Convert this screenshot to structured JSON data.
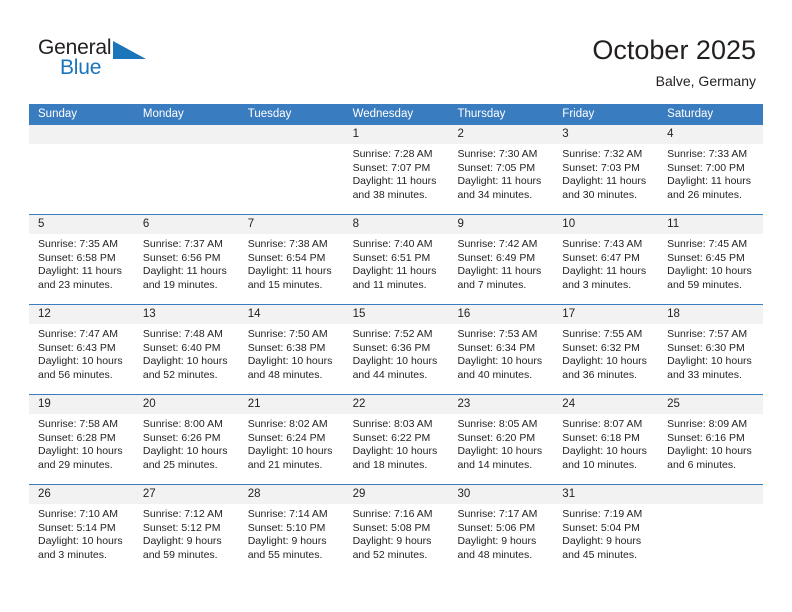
{
  "brand": {
    "name_top": "General",
    "name_bottom": "Blue",
    "color_dark": "#231f20",
    "color_blue": "#1b75bb",
    "triangle_icon": "triangle-icon"
  },
  "header": {
    "title": "October 2025",
    "subtitle": "Balve, Germany"
  },
  "theme": {
    "header_blue": "#3a7cc0",
    "daynum_band": "#f2f2f2",
    "text": "#231f20"
  },
  "weekdays": [
    "Sunday",
    "Monday",
    "Tuesday",
    "Wednesday",
    "Thursday",
    "Friday",
    "Saturday"
  ],
  "weeks": [
    [
      {
        "day": "",
        "sunrise": "",
        "sunset": "",
        "daylight1": "",
        "daylight2": ""
      },
      {
        "day": "",
        "sunrise": "",
        "sunset": "",
        "daylight1": "",
        "daylight2": ""
      },
      {
        "day": "",
        "sunrise": "",
        "sunset": "",
        "daylight1": "",
        "daylight2": ""
      },
      {
        "day": "1",
        "sunrise": "Sunrise: 7:28 AM",
        "sunset": "Sunset: 7:07 PM",
        "daylight1": "Daylight: 11 hours",
        "daylight2": "and 38 minutes."
      },
      {
        "day": "2",
        "sunrise": "Sunrise: 7:30 AM",
        "sunset": "Sunset: 7:05 PM",
        "daylight1": "Daylight: 11 hours",
        "daylight2": "and 34 minutes."
      },
      {
        "day": "3",
        "sunrise": "Sunrise: 7:32 AM",
        "sunset": "Sunset: 7:03 PM",
        "daylight1": "Daylight: 11 hours",
        "daylight2": "and 30 minutes."
      },
      {
        "day": "4",
        "sunrise": "Sunrise: 7:33 AM",
        "sunset": "Sunset: 7:00 PM",
        "daylight1": "Daylight: 11 hours",
        "daylight2": "and 26 minutes."
      }
    ],
    [
      {
        "day": "5",
        "sunrise": "Sunrise: 7:35 AM",
        "sunset": "Sunset: 6:58 PM",
        "daylight1": "Daylight: 11 hours",
        "daylight2": "and 23 minutes."
      },
      {
        "day": "6",
        "sunrise": "Sunrise: 7:37 AM",
        "sunset": "Sunset: 6:56 PM",
        "daylight1": "Daylight: 11 hours",
        "daylight2": "and 19 minutes."
      },
      {
        "day": "7",
        "sunrise": "Sunrise: 7:38 AM",
        "sunset": "Sunset: 6:54 PM",
        "daylight1": "Daylight: 11 hours",
        "daylight2": "and 15 minutes."
      },
      {
        "day": "8",
        "sunrise": "Sunrise: 7:40 AM",
        "sunset": "Sunset: 6:51 PM",
        "daylight1": "Daylight: 11 hours",
        "daylight2": "and 11 minutes."
      },
      {
        "day": "9",
        "sunrise": "Sunrise: 7:42 AM",
        "sunset": "Sunset: 6:49 PM",
        "daylight1": "Daylight: 11 hours",
        "daylight2": "and 7 minutes."
      },
      {
        "day": "10",
        "sunrise": "Sunrise: 7:43 AM",
        "sunset": "Sunset: 6:47 PM",
        "daylight1": "Daylight: 11 hours",
        "daylight2": "and 3 minutes."
      },
      {
        "day": "11",
        "sunrise": "Sunrise: 7:45 AM",
        "sunset": "Sunset: 6:45 PM",
        "daylight1": "Daylight: 10 hours",
        "daylight2": "and 59 minutes."
      }
    ],
    [
      {
        "day": "12",
        "sunrise": "Sunrise: 7:47 AM",
        "sunset": "Sunset: 6:43 PM",
        "daylight1": "Daylight: 10 hours",
        "daylight2": "and 56 minutes."
      },
      {
        "day": "13",
        "sunrise": "Sunrise: 7:48 AM",
        "sunset": "Sunset: 6:40 PM",
        "daylight1": "Daylight: 10 hours",
        "daylight2": "and 52 minutes."
      },
      {
        "day": "14",
        "sunrise": "Sunrise: 7:50 AM",
        "sunset": "Sunset: 6:38 PM",
        "daylight1": "Daylight: 10 hours",
        "daylight2": "and 48 minutes."
      },
      {
        "day": "15",
        "sunrise": "Sunrise: 7:52 AM",
        "sunset": "Sunset: 6:36 PM",
        "daylight1": "Daylight: 10 hours",
        "daylight2": "and 44 minutes."
      },
      {
        "day": "16",
        "sunrise": "Sunrise: 7:53 AM",
        "sunset": "Sunset: 6:34 PM",
        "daylight1": "Daylight: 10 hours",
        "daylight2": "and 40 minutes."
      },
      {
        "day": "17",
        "sunrise": "Sunrise: 7:55 AM",
        "sunset": "Sunset: 6:32 PM",
        "daylight1": "Daylight: 10 hours",
        "daylight2": "and 36 minutes."
      },
      {
        "day": "18",
        "sunrise": "Sunrise: 7:57 AM",
        "sunset": "Sunset: 6:30 PM",
        "daylight1": "Daylight: 10 hours",
        "daylight2": "and 33 minutes."
      }
    ],
    [
      {
        "day": "19",
        "sunrise": "Sunrise: 7:58 AM",
        "sunset": "Sunset: 6:28 PM",
        "daylight1": "Daylight: 10 hours",
        "daylight2": "and 29 minutes."
      },
      {
        "day": "20",
        "sunrise": "Sunrise: 8:00 AM",
        "sunset": "Sunset: 6:26 PM",
        "daylight1": "Daylight: 10 hours",
        "daylight2": "and 25 minutes."
      },
      {
        "day": "21",
        "sunrise": "Sunrise: 8:02 AM",
        "sunset": "Sunset: 6:24 PM",
        "daylight1": "Daylight: 10 hours",
        "daylight2": "and 21 minutes."
      },
      {
        "day": "22",
        "sunrise": "Sunrise: 8:03 AM",
        "sunset": "Sunset: 6:22 PM",
        "daylight1": "Daylight: 10 hours",
        "daylight2": "and 18 minutes."
      },
      {
        "day": "23",
        "sunrise": "Sunrise: 8:05 AM",
        "sunset": "Sunset: 6:20 PM",
        "daylight1": "Daylight: 10 hours",
        "daylight2": "and 14 minutes."
      },
      {
        "day": "24",
        "sunrise": "Sunrise: 8:07 AM",
        "sunset": "Sunset: 6:18 PM",
        "daylight1": "Daylight: 10 hours",
        "daylight2": "and 10 minutes."
      },
      {
        "day": "25",
        "sunrise": "Sunrise: 8:09 AM",
        "sunset": "Sunset: 6:16 PM",
        "daylight1": "Daylight: 10 hours",
        "daylight2": "and 6 minutes."
      }
    ],
    [
      {
        "day": "26",
        "sunrise": "Sunrise: 7:10 AM",
        "sunset": "Sunset: 5:14 PM",
        "daylight1": "Daylight: 10 hours",
        "daylight2": "and 3 minutes."
      },
      {
        "day": "27",
        "sunrise": "Sunrise: 7:12 AM",
        "sunset": "Sunset: 5:12 PM",
        "daylight1": "Daylight: 9 hours",
        "daylight2": "and 59 minutes."
      },
      {
        "day": "28",
        "sunrise": "Sunrise: 7:14 AM",
        "sunset": "Sunset: 5:10 PM",
        "daylight1": "Daylight: 9 hours",
        "daylight2": "and 55 minutes."
      },
      {
        "day": "29",
        "sunrise": "Sunrise: 7:16 AM",
        "sunset": "Sunset: 5:08 PM",
        "daylight1": "Daylight: 9 hours",
        "daylight2": "and 52 minutes."
      },
      {
        "day": "30",
        "sunrise": "Sunrise: 7:17 AM",
        "sunset": "Sunset: 5:06 PM",
        "daylight1": "Daylight: 9 hours",
        "daylight2": "and 48 minutes."
      },
      {
        "day": "31",
        "sunrise": "Sunrise: 7:19 AM",
        "sunset": "Sunset: 5:04 PM",
        "daylight1": "Daylight: 9 hours",
        "daylight2": "and 45 minutes."
      },
      {
        "day": "",
        "sunrise": "",
        "sunset": "",
        "daylight1": "",
        "daylight2": ""
      }
    ]
  ]
}
